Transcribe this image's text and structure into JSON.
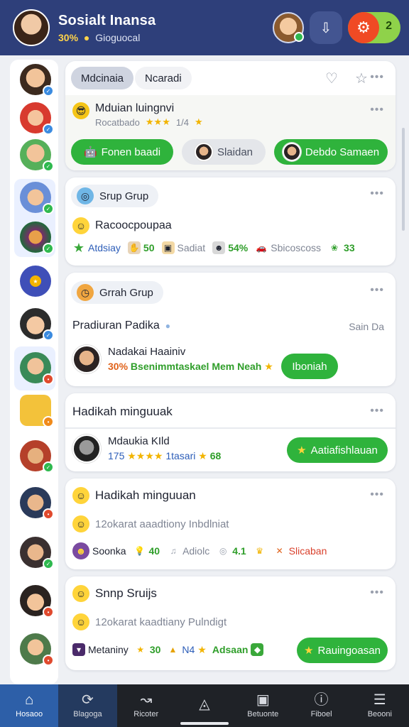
{
  "header": {
    "title": "Sosialt Inansa",
    "sub_pct": "30%",
    "sub_text": "Gioguocal",
    "toggle_count": "2"
  },
  "card1": {
    "tab_active": "Mdcinaia",
    "tab_other": "Ncaradi",
    "title": "Mduian luingnvi",
    "subtitle": "Rocatbado",
    "rating_text": "1/4",
    "btn1": "Fonen baadi",
    "btn2": "Slaidan",
    "btn3": "Debdo Samaen"
  },
  "card2": {
    "chip": "Srup Grup",
    "title": "Racoocpoupaa",
    "stat1_label": "Atdsiay",
    "stat1_val": "50",
    "stat2_label": "Sadiat",
    "stat2_val": "54%",
    "stat3_label": "Sbicoscoss",
    "stat3_val": "33"
  },
  "card3": {
    "chip": "Grrah Grup",
    "title": "Pradiuran Padika",
    "right_text": "Sain Da",
    "person_name": "Nadakai Haainiv",
    "person_pct": "30%",
    "person_desc": "Bsenimmtaskael Mem Neah",
    "btn": "Iboniah"
  },
  "card4": {
    "title": "Hadikah minguuak",
    "person_name": "Mdaukia KIld",
    "rating_num": "175",
    "rating_text": "1tasari",
    "rating_val": "68",
    "btn": "Aatiafishlauan"
  },
  "card5": {
    "title": "Hadikah minguuan",
    "desc": "12okarat aaadtiony Inbdlniat",
    "stat1_label": "Soonka",
    "stat1_val": "40",
    "stat2_label": "Adiolc",
    "stat2_val": "4.1",
    "stat3_label": "Slicaban"
  },
  "card6": {
    "title": "Snnp Sruijs",
    "desc": "12okarat kaadtiany Pulndigt",
    "stat1_label": "Metaniny",
    "stat1_val": "30",
    "stat2_label": "N4",
    "stat3_label": "Adsaan",
    "btn": "Rauingoasan"
  },
  "nav": [
    {
      "label": "Hosaoo"
    },
    {
      "label": "Blagoga"
    },
    {
      "label": "Ricoter"
    },
    {
      "label": ""
    },
    {
      "label": "Betuonte"
    },
    {
      "label": "Fiboel"
    },
    {
      "label": "Beooni"
    }
  ]
}
